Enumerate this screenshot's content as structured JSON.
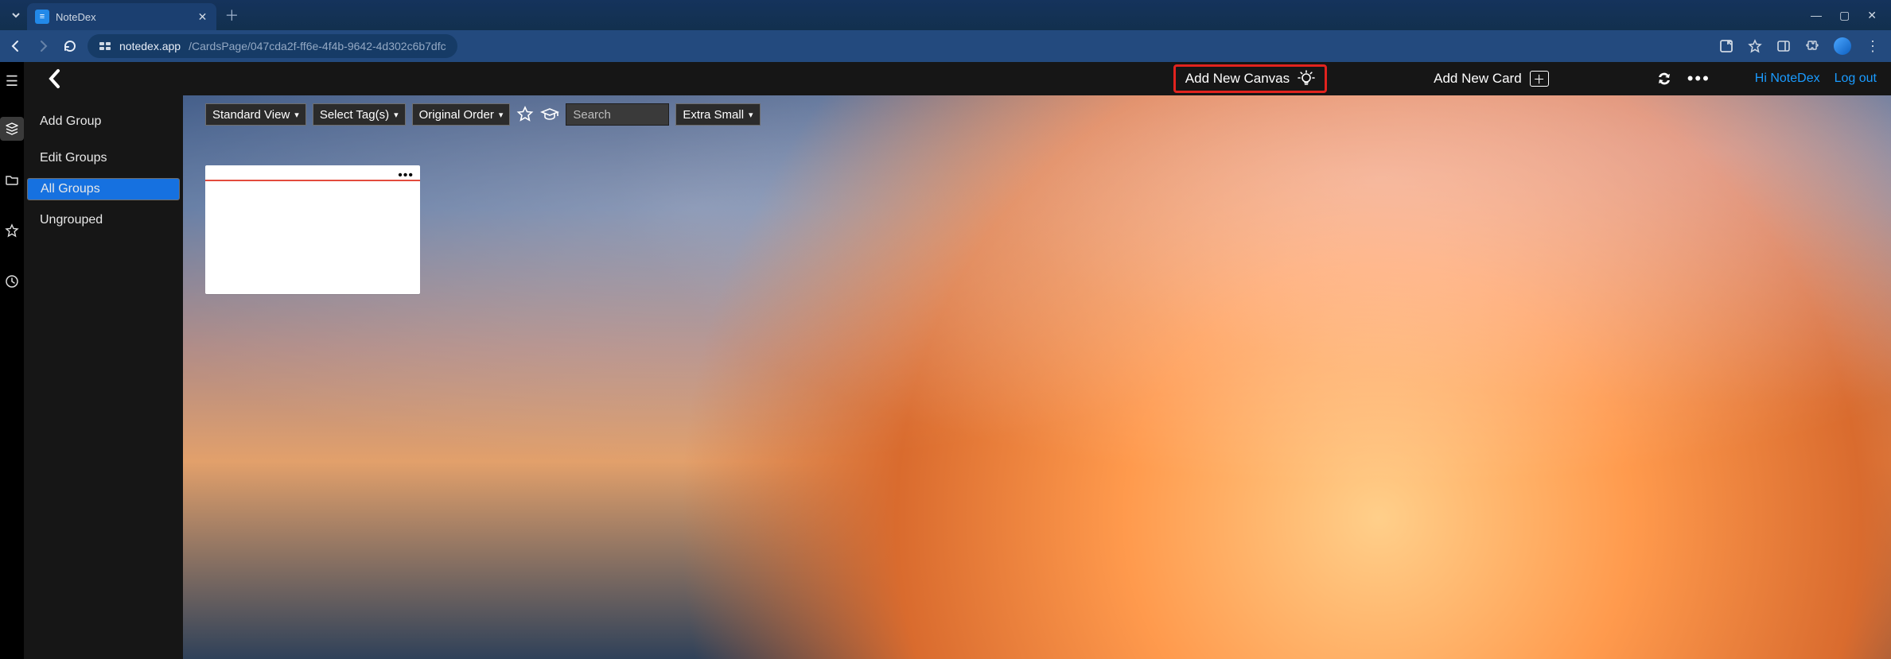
{
  "browser": {
    "tab_title": "NoteDex",
    "url_domain": "notedex.app",
    "url_path": "/CardsPage/047cda2f-ff6e-4f4b-9642-4d302c6b7dfc"
  },
  "header": {
    "add_canvas": "Add New Canvas",
    "add_card": "Add New Card",
    "greeting": "Hi NoteDex",
    "logout": "Log out"
  },
  "sidebar": {
    "items": [
      {
        "label": "Add Group",
        "selected": false
      },
      {
        "label": "Edit Groups",
        "selected": false
      },
      {
        "label": "All Groups",
        "selected": true
      },
      {
        "label": "Ungrouped",
        "selected": false
      }
    ]
  },
  "toolbar": {
    "view": "Standard View",
    "tags": "Select Tag(s)",
    "order": "Original Order",
    "search_placeholder": "Search",
    "size": "Extra Small"
  }
}
